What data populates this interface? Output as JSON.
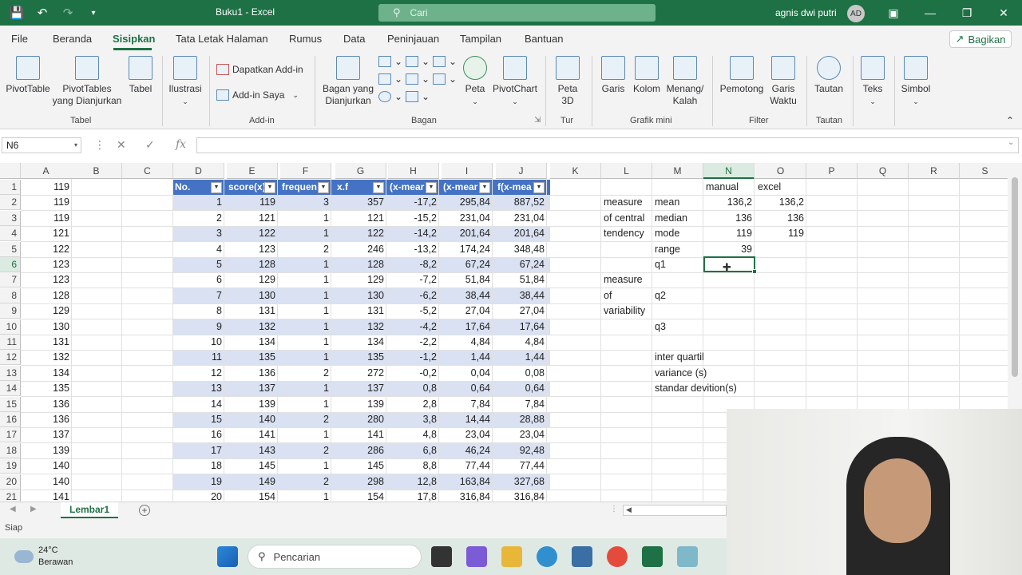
{
  "titlebar": {
    "title": "Buku1  -  Excel",
    "search_placeholder": "Cari",
    "user": "agnis dwi putri",
    "avatar": "AD",
    "icons": [
      "save-icon",
      "undo-icon",
      "redo-icon",
      "customize-icon"
    ]
  },
  "tabs": [
    "File",
    "Beranda",
    "Sisipkan",
    "Tata Letak Halaman",
    "Rumus",
    "Data",
    "Peninjauan",
    "Tampilan",
    "Bantuan"
  ],
  "active_tab": "Sisipkan",
  "share_label": "Bagikan",
  "ribbon": {
    "pivottable": "PivotTable",
    "pivottables_rec": "PivotTables yang Dianjurkan",
    "tabel": "Tabel",
    "ilustrasi": "Ilustrasi",
    "get_addins": "Dapatkan Add-in",
    "my_addins": "Add-in Saya",
    "rec_charts": "Bagan yang Dianjurkan",
    "peta": "Peta",
    "pivotchart": "PivotChart",
    "peta3d": "Peta 3D",
    "garis": "Garis",
    "kolom": "Kolom",
    "menang_kalah": "Menang/ Kalah",
    "pemotong": "Pemotong",
    "garis_waktu": "Garis Waktu",
    "tautan": "Tautan",
    "teks": "Teks",
    "simbol": "Simbol",
    "groups": {
      "tabel": "Tabel",
      "addin": "Add-in",
      "bagan": "Bagan",
      "tur": "Tur",
      "grafik_mini": "Grafik mini",
      "filter": "Filter",
      "tautan": "Tautan"
    }
  },
  "formula_bar": {
    "name_box": "N6",
    "formula": ""
  },
  "columns": [
    "A",
    "B",
    "C",
    "D",
    "E",
    "F",
    "G",
    "H",
    "I",
    "J",
    "K",
    "L",
    "M",
    "N",
    "O",
    "P",
    "Q",
    "R",
    "S"
  ],
  "rows": [
    "1",
    "2",
    "3",
    "4",
    "5",
    "6",
    "7",
    "8",
    "9",
    "10",
    "11",
    "12",
    "13",
    "14",
    "15",
    "16",
    "17",
    "18",
    "19",
    "20",
    "21"
  ],
  "colA": [
    "119",
    "119",
    "119",
    "121",
    "122",
    "123",
    "123",
    "128",
    "129",
    "130",
    "131",
    "132",
    "134",
    "135",
    "136",
    "136",
    "137",
    "139",
    "140",
    "140",
    "141"
  ],
  "table_headers": [
    "No.",
    "score(x)",
    "frequen",
    "x.f",
    "(x-mear",
    "(x-mear",
    "f(x-mea"
  ],
  "table_rows": [
    [
      "1",
      "119",
      "3",
      "357",
      "-17,2",
      "295,84",
      "887,52"
    ],
    [
      "2",
      "121",
      "1",
      "121",
      "-15,2",
      "231,04",
      "231,04"
    ],
    [
      "3",
      "122",
      "1",
      "122",
      "-14,2",
      "201,64",
      "201,64"
    ],
    [
      "4",
      "123",
      "2",
      "246",
      "-13,2",
      "174,24",
      "348,48"
    ],
    [
      "5",
      "128",
      "1",
      "128",
      "-8,2",
      "67,24",
      "67,24"
    ],
    [
      "6",
      "129",
      "1",
      "129",
      "-7,2",
      "51,84",
      "51,84"
    ],
    [
      "7",
      "130",
      "1",
      "130",
      "-6,2",
      "38,44",
      "38,44"
    ],
    [
      "8",
      "131",
      "1",
      "131",
      "-5,2",
      "27,04",
      "27,04"
    ],
    [
      "9",
      "132",
      "1",
      "132",
      "-4,2",
      "17,64",
      "17,64"
    ],
    [
      "10",
      "134",
      "1",
      "134",
      "-2,2",
      "4,84",
      "4,84"
    ],
    [
      "11",
      "135",
      "1",
      "135",
      "-1,2",
      "1,44",
      "1,44"
    ],
    [
      "12",
      "136",
      "2",
      "272",
      "-0,2",
      "0,04",
      "0,08"
    ],
    [
      "13",
      "137",
      "1",
      "137",
      "0,8",
      "0,64",
      "0,64"
    ],
    [
      "14",
      "139",
      "1",
      "139",
      "2,8",
      "7,84",
      "7,84"
    ],
    [
      "15",
      "140",
      "2",
      "280",
      "3,8",
      "14,44",
      "28,88"
    ],
    [
      "16",
      "141",
      "1",
      "141",
      "4,8",
      "23,04",
      "23,04"
    ],
    [
      "17",
      "143",
      "2",
      "286",
      "6,8",
      "46,24",
      "92,48"
    ],
    [
      "18",
      "145",
      "1",
      "145",
      "8,8",
      "77,44",
      "77,44"
    ],
    [
      "19",
      "149",
      "2",
      "298",
      "12,8",
      "163,84",
      "327,68"
    ],
    [
      "20",
      "154",
      "1",
      "154",
      "17,8",
      "316,84",
      "316,84"
    ]
  ],
  "stats": {
    "manual_header": "manual",
    "excel_header": "excel",
    "L2": "measure",
    "L3": "of central",
    "L4": "tendency",
    "L7": "measure",
    "L8": "of",
    "L9": "variability",
    "M2": "mean",
    "M3": "median",
    "M4": "mode",
    "M5": "range",
    "M6": "q1",
    "M8": "q2",
    "M10": "q3",
    "M12": "inter quartil",
    "M13": "variance (s)",
    "M14": "standar devition(s)",
    "N2": "136,2",
    "N3": "136",
    "N4": "119",
    "N5": "39",
    "O2": "136,2",
    "O3": "136",
    "O4": "119"
  },
  "sheet_tab": "Lembar1",
  "status": "Siap",
  "taskbar": {
    "temp": "24°C",
    "weather": "Berawan",
    "search": "Pencarian"
  },
  "colors": {
    "excel_green": "#1e7145",
    "table_header": "#4472c4",
    "table_band": "#d9e1f2"
  }
}
